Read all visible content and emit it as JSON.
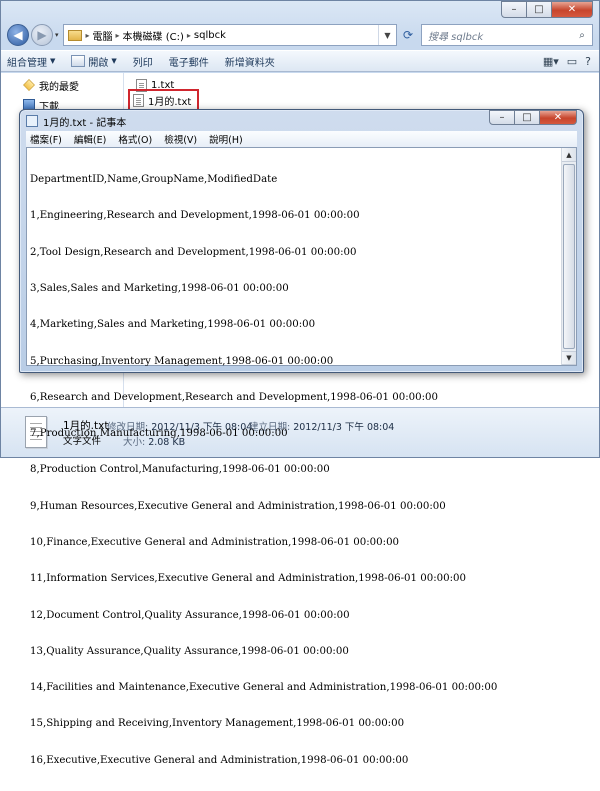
{
  "explorer": {
    "window_controls": {
      "minimize": "–",
      "maximize": "□",
      "close": "✕"
    },
    "nav": {
      "back": "◀",
      "forward": "▶",
      "history": "▾"
    },
    "breadcrumb": [
      "電腦",
      "本機磁碟 (C:)",
      "sqlbck"
    ],
    "breadcrumb_sep": "▸",
    "search_placeholder": "搜尋 sqlbck",
    "toolbar": {
      "organize": "組合管理",
      "open": "開啟",
      "print": "列印",
      "email": "電子郵件",
      "new_folder": "新增資料夾"
    },
    "nav_pane": {
      "favorites": "我的最愛",
      "downloads": "下載"
    },
    "files": [
      "1.txt",
      "1月的.txt"
    ],
    "details": {
      "name": "1月的.txt",
      "type": "文字文件",
      "modified_label": "修改日期:",
      "modified": "2012/11/3 下午 08:04",
      "created_label": "建立日期:",
      "created": "2012/11/3 下午 08:04",
      "size_label": "大小:",
      "size": "2.08 KB"
    }
  },
  "notepad": {
    "title": "1月的.txt - 記事本",
    "menu": [
      "檔案(F)",
      "編輯(E)",
      "格式(O)",
      "檢視(V)",
      "說明(H)"
    ],
    "lines": [
      "DepartmentID,Name,GroupName,ModifiedDate",
      "1,Engineering,Research and Development,1998-06-01 00:00:00",
      "2,Tool Design,Research and Development,1998-06-01 00:00:00",
      "3,Sales,Sales and Marketing,1998-06-01 00:00:00",
      "4,Marketing,Sales and Marketing,1998-06-01 00:00:00",
      "5,Purchasing,Inventory Management,1998-06-01 00:00:00",
      "6,Research and Development,Research and Development,1998-06-01 00:00:00",
      "7,Production,Manufacturing,1998-06-01 00:00:00",
      "8,Production Control,Manufacturing,1998-06-01 00:00:00",
      "9,Human Resources,Executive General and Administration,1998-06-01 00:00:00",
      "10,Finance,Executive General and Administration,1998-06-01 00:00:00",
      "11,Information Services,Executive General and Administration,1998-06-01 00:00:00",
      "12,Document Control,Quality Assurance,1998-06-01 00:00:00",
      "13,Quality Assurance,Quality Assurance,1998-06-01 00:00:00",
      "14,Facilities and Maintenance,Executive General and Administration,1998-06-01 00:00:00",
      "15,Shipping and Receiving,Inventory Management,1998-06-01 00:00:00",
      "16,Executive,Executive General and Administration,1998-06-01 00:00:00"
    ]
  }
}
